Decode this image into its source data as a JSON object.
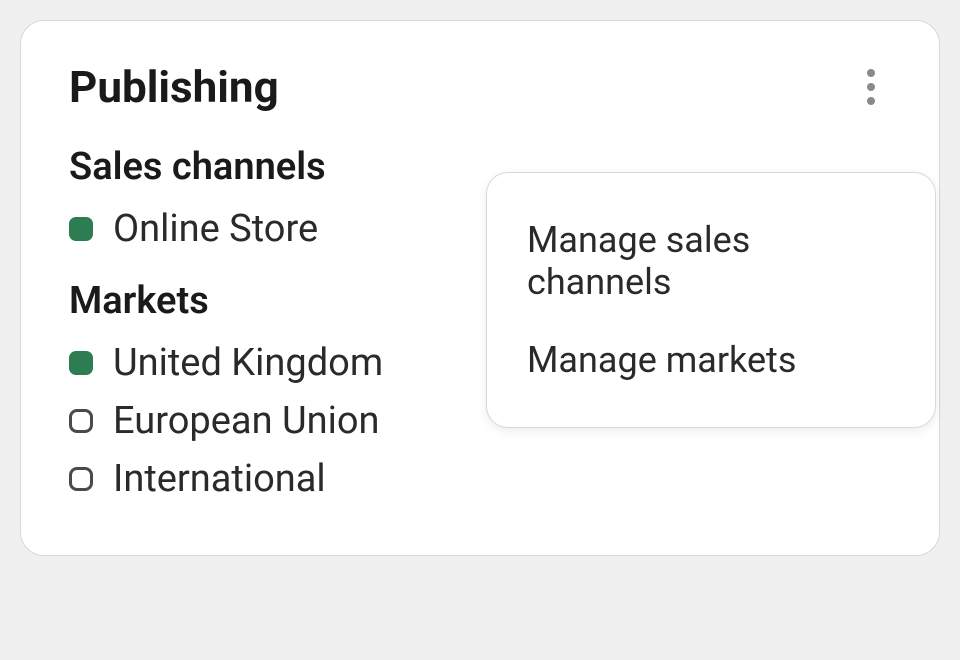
{
  "card": {
    "title": "Publishing"
  },
  "sections": {
    "salesChannels": {
      "title": "Sales channels",
      "items": [
        {
          "label": "Online Store",
          "active": true
        }
      ]
    },
    "markets": {
      "title": "Markets",
      "items": [
        {
          "label": "United Kingdom",
          "active": true
        },
        {
          "label": "European Union",
          "active": false
        },
        {
          "label": "International",
          "active": false
        }
      ]
    }
  },
  "popover": {
    "items": [
      {
        "label": "Manage sales channels"
      },
      {
        "label": "Manage markets"
      }
    ]
  },
  "colors": {
    "activeStatus": "#2e7d52",
    "cardBackground": "#ffffff",
    "pageBackground": "#f0f0f0"
  }
}
